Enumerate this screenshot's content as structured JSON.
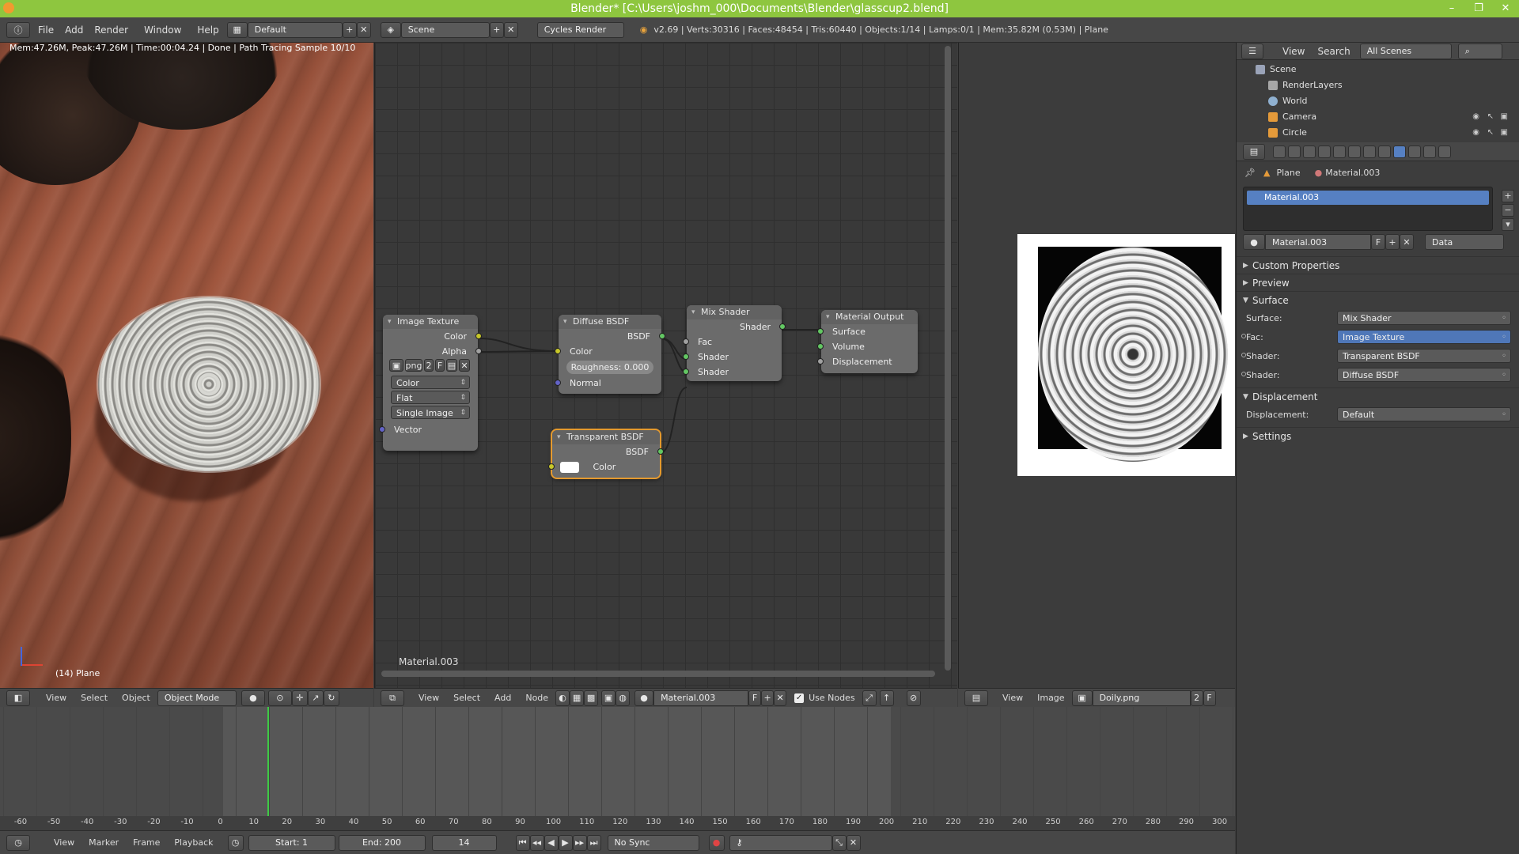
{
  "window": {
    "title": "Blender* [C:\\Users\\joshm_000\\Documents\\Blender\\glasscup2.blend]",
    "brand_color": "#8ec63f"
  },
  "info_header": {
    "menus": [
      "File",
      "Add",
      "Render",
      "Window",
      "Help"
    ],
    "layout": "Default",
    "scene": "Scene",
    "engine": "Cycles Render",
    "stats": "v2.69 | Verts:30316 | Faces:48454 | Tris:60440 | Objects:1/14 | Lamps:0/1 | Mem:35.82M (0.53M) | Plane"
  },
  "viewport": {
    "status": "Mem:47.26M, Peak:47.26M | Time:00:04.24 | Done | Path Tracing Sample 10/10",
    "object_label": "(14) Plane",
    "header": {
      "menus": [
        "View",
        "Select",
        "Object"
      ],
      "mode": "Object Mode"
    }
  },
  "node_editor": {
    "material_label": "Material.003",
    "nodes": {
      "image_texture": {
        "title": "Image Texture",
        "out_color": "Color",
        "out_alpha": "Alpha",
        "image_name": "png",
        "image_users": "2",
        "fake_user": "F",
        "color_space": "Color",
        "projection": "Flat",
        "source": "Single Image",
        "in_vector": "Vector"
      },
      "diffuse": {
        "title": "Diffuse BSDF",
        "out": "BSDF",
        "in_color": "Color",
        "roughness": "Roughness: 0.000",
        "in_normal": "Normal"
      },
      "transparent": {
        "title": "Transparent BSDF",
        "out": "BSDF",
        "in_color": "Color"
      },
      "mix": {
        "title": "Mix Shader",
        "out": "Shader",
        "in_fac": "Fac",
        "in_shader1": "Shader",
        "in_shader2": "Shader"
      },
      "output": {
        "title": "Material Output",
        "in_surface": "Surface",
        "in_volume": "Volume",
        "in_displacement": "Displacement"
      }
    },
    "header": {
      "menus": [
        "View",
        "Select",
        "Add",
        "Node"
      ],
      "material": "Material.003",
      "fake_user": "F",
      "use_nodes": "Use Nodes"
    }
  },
  "image_editor": {
    "header": {
      "menus": [
        "View",
        "Image"
      ],
      "image": "Doily.png",
      "users": "2",
      "fake_user": "F"
    }
  },
  "outliner": {
    "header": {
      "view": "View",
      "search": "Search",
      "filter": "All Scenes"
    },
    "rows": [
      "Scene",
      "RenderLayers",
      "World",
      "Camera",
      "Circle"
    ]
  },
  "properties": {
    "breadcrumb": {
      "object": "Plane",
      "material": "Material.003"
    },
    "slot": "Material.003",
    "material_field": "Material.003",
    "fake_user": "F",
    "link": "Data",
    "panels": {
      "custom_properties": "Custom Properties",
      "preview": "Preview",
      "surface": "Surface",
      "displacement": "Displacement",
      "settings": "Settings"
    },
    "surface": {
      "surface_label": "Surface:",
      "surface_value": "Mix Shader",
      "fac_label": "Fac:",
      "fac_value": "Image Texture",
      "shader1_label": "Shader:",
      "shader1_value": "Transparent BSDF",
      "shader2_label": "Shader:",
      "shader2_value": "Diffuse BSDF"
    },
    "displacement": {
      "label": "Displacement:",
      "value": "Default"
    }
  },
  "timeline": {
    "ticks": [
      "-60",
      "-50",
      "-40",
      "-30",
      "-20",
      "-10",
      "0",
      "10",
      "20",
      "30",
      "40",
      "50",
      "60",
      "70",
      "80",
      "90",
      "100",
      "110",
      "120",
      "130",
      "140",
      "150",
      "160",
      "170",
      "180",
      "190",
      "200",
      "210",
      "220",
      "230",
      "240",
      "250",
      "260",
      "270",
      "280",
      "290",
      "300"
    ],
    "current_frame": 14,
    "header": {
      "menus": [
        "View",
        "Marker",
        "Frame",
        "Playback"
      ],
      "start": "Start: 1",
      "end": "End: 200",
      "frame": "14",
      "sync": "No Sync"
    }
  }
}
